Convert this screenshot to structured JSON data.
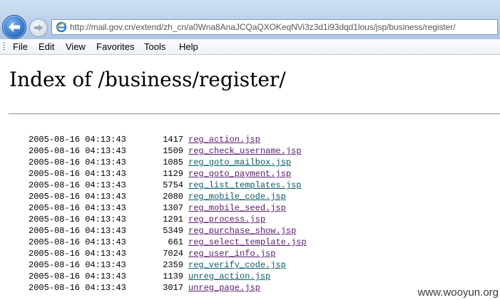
{
  "browser": {
    "url": "http://mail.gov.cn/extend/zh_cn/a0Wna8AnaJCQaQXOKeqNVi3z3d1i93dqd1lous/jsp/business/register/",
    "menu": [
      {
        "label": "File",
        "icon": "none"
      },
      {
        "label": "Edit",
        "icon": "none"
      },
      {
        "label": "View",
        "icon": "none"
      },
      {
        "label": "Favorites",
        "icon": "none"
      },
      {
        "label": "Tools",
        "icon": "none"
      },
      {
        "label": "Help",
        "icon": "none"
      }
    ],
    "icons": {
      "back": "back-arrow-icon",
      "forward": "forward-arrow-icon",
      "page": "ie-page-icon"
    }
  },
  "page": {
    "title": "Index of /business/register/",
    "files": [
      {
        "date": "2005-08-16 04:13:43",
        "size": "1417",
        "name": "reg_action.jsp",
        "visited": true
      },
      {
        "date": "2005-08-16 04:13:43",
        "size": "1509",
        "name": "reg_check_username.jsp",
        "visited": true
      },
      {
        "date": "2005-08-16 04:13:43",
        "size": "1085",
        "name": "reg_goto_mailbox.jsp",
        "visited": false
      },
      {
        "date": "2005-08-16 04:13:43",
        "size": "1129",
        "name": "reg_goto_payment.jsp",
        "visited": true
      },
      {
        "date": "2005-08-16 04:13:43",
        "size": "5754",
        "name": "reg_list_templates.jsp",
        "visited": false
      },
      {
        "date": "2005-08-16 04:13:43",
        "size": "2080",
        "name": "reg_mobile_code.jsp",
        "visited": false
      },
      {
        "date": "2005-08-16 04:13:43",
        "size": "1307",
        "name": "reg_mobile_seed.jsp",
        "visited": true
      },
      {
        "date": "2005-08-16 04:13:43",
        "size": "1291",
        "name": "reg_process.jsp",
        "visited": true
      },
      {
        "date": "2005-08-16 04:13:43",
        "size": "5349",
        "name": "reg_purchase_show.jsp",
        "visited": true
      },
      {
        "date": "2005-08-16 04:13:43",
        "size": "661",
        "name": "reg_select_template.jsp",
        "visited": true
      },
      {
        "date": "2005-08-16 04:13:43",
        "size": "7024",
        "name": "reg_user_info.jsp",
        "visited": true
      },
      {
        "date": "2005-08-16 04:13:43",
        "size": "2359",
        "name": "reg_verify_code.jsp",
        "visited": false
      },
      {
        "date": "2005-08-16 04:13:43",
        "size": "1139",
        "name": "unreg_action.jsp",
        "visited": false
      },
      {
        "date": "2005-08-16 04:13:43",
        "size": "3017",
        "name": "unreg_page.jsp",
        "visited": true
      }
    ]
  },
  "watermark": "www.wooyun.org",
  "colors": {
    "visited_link": "#5b1a6e",
    "unvisited_link": "#0b5a66",
    "chrome": "#b9d0ea"
  }
}
